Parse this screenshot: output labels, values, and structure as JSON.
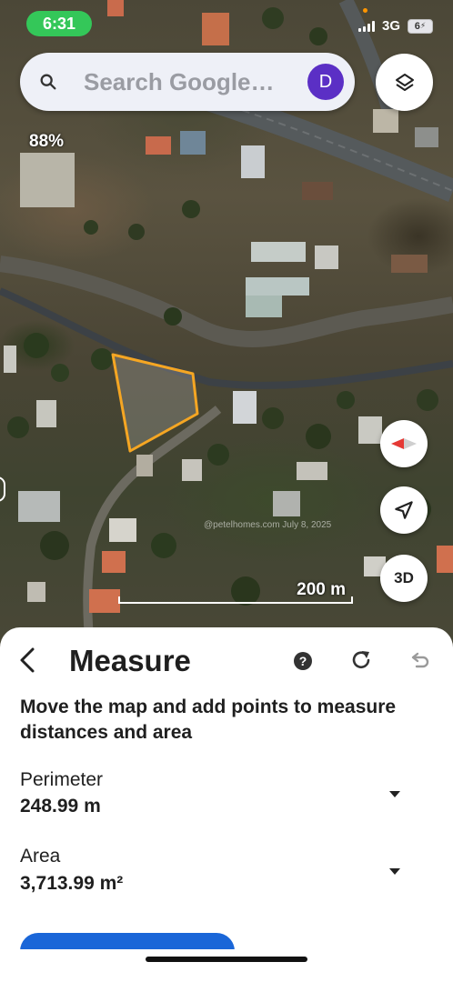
{
  "status_bar": {
    "time": "6:31",
    "network": "3G",
    "battery": "6"
  },
  "search": {
    "placeholder": "Search Google…",
    "avatar_initial": "D"
  },
  "map": {
    "zoom_percent": "88%",
    "scale_label": "200 m",
    "watermark": "@petelhomes.com July 8, 2025",
    "measured_polygon_color": "#f5a623",
    "button_3d_label": "3D"
  },
  "measure_sheet": {
    "title": "Measure",
    "instructions": "Move the map and add points to measure distances and area",
    "perimeter": {
      "label": "Perimeter",
      "value": "248.99 m"
    },
    "area": {
      "label": "Area",
      "value": "3,713.99 m²"
    },
    "accent_color": "#1a66d8"
  }
}
